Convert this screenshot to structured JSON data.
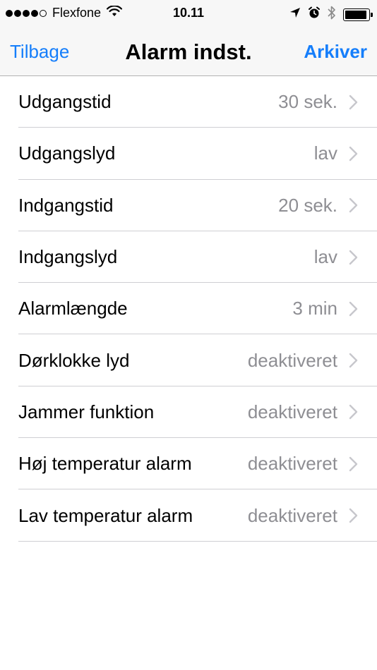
{
  "status_bar": {
    "carrier": "Flexfone",
    "time": "10.11",
    "battery_level": 0.95,
    "signal_bars": 4
  },
  "nav": {
    "back_label": "Tilbage",
    "title": "Alarm indst.",
    "save_label": "Arkiver"
  },
  "settings": [
    {
      "label": "Udgangstid",
      "value": "30 sek."
    },
    {
      "label": "Udgangslyd",
      "value": "lav"
    },
    {
      "label": "Indgangstid",
      "value": "20 sek."
    },
    {
      "label": "Indgangslyd",
      "value": "lav"
    },
    {
      "label": "Alarmlængde",
      "value": "3 min"
    },
    {
      "label": "Dørklokke lyd",
      "value": "deaktiveret"
    },
    {
      "label": "Jammer funktion",
      "value": "deaktiveret"
    },
    {
      "label": "Høj temperatur alarm",
      "value": "deaktiveret"
    },
    {
      "label": "Lav temperatur alarm",
      "value": "deaktiveret"
    }
  ],
  "colors": {
    "accent": "#157efb",
    "secondary_text": "#8e8e93",
    "chevron": "#c7c7cc",
    "bar_background": "#f7f7f7"
  }
}
